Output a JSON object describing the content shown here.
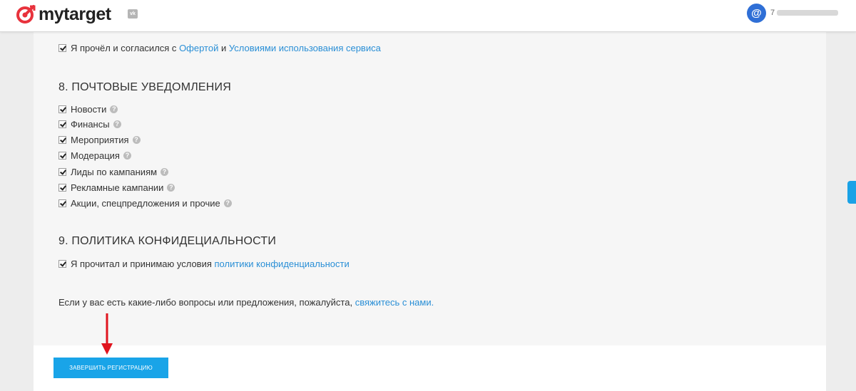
{
  "header": {
    "logo_text": "mytarget",
    "vk_badge": "vk",
    "avatar_glyph": "@",
    "user_name_prefix": "7"
  },
  "agreement": {
    "prefix": "Я прочёл и согласился с",
    "offer_link": "Офертой",
    "and": "и",
    "terms_link": "Условиями использования сервиса",
    "checked": true
  },
  "notifications": {
    "title": "8. ПОЧТОВЫЕ УВЕДОМЛЕНИЯ",
    "items": [
      {
        "label": "Новости",
        "checked": true
      },
      {
        "label": "Финансы",
        "checked": true
      },
      {
        "label": "Мероприятия",
        "checked": true
      },
      {
        "label": "Модерация",
        "checked": true
      },
      {
        "label": "Лиды по кампаниям",
        "checked": true
      },
      {
        "label": "Рекламные кампании",
        "checked": true
      },
      {
        "label": "Акции, спецпредложения и прочие",
        "checked": true
      }
    ],
    "help_glyph": "?"
  },
  "privacy": {
    "title": "9. ПОЛИТИКА КОНФИДЕЦИАЛЬНОСТИ",
    "prefix": "Я прочитал и принимаю условия",
    "link": "политики конфиденциальности",
    "checked": true
  },
  "contact": {
    "text": "Если у вас есть какие-либо вопросы или предложения, пожалуйста,",
    "link": "свяжитесь с нами."
  },
  "footer": {
    "finish_button": "ЗАВЕРШИТЬ РЕГИСТРАЦИЮ"
  },
  "colors": {
    "accent": "#19a4e8",
    "link": "#2a8fd6",
    "brand_red": "#e8323c",
    "arrow_red": "#e0141e"
  }
}
